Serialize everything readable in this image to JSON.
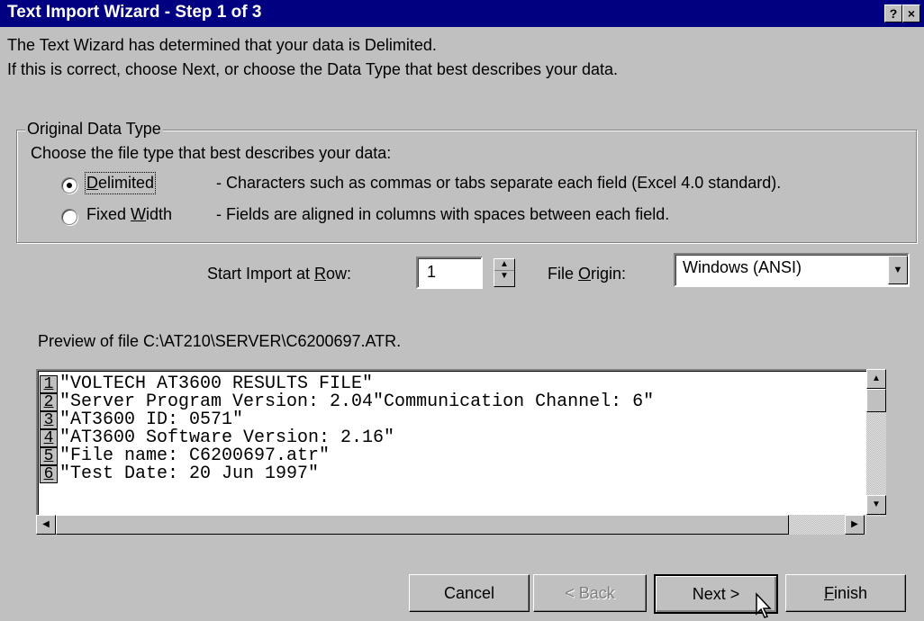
{
  "window": {
    "title": "Text Import Wizard - Step 1 of 3",
    "help_btn": "?",
    "close_btn": "×"
  },
  "intro": {
    "line1": "The Text Wizard has determined that your data is Delimited.",
    "line2": "If this is correct, choose Next, or choose the Data Type that best describes your data."
  },
  "data_type": {
    "legend": "Original Data Type",
    "prompt": "Choose the file type that best describes your data:",
    "options": [
      {
        "label": "Delimited",
        "desc": "- Characters such as commas or tabs separate each field (Excel 4.0 standard).",
        "selected": true
      },
      {
        "label": "Fixed Width",
        "desc": "- Fields are aligned in columns with spaces between each field.",
        "selected": false
      }
    ]
  },
  "import_row": {
    "label_pre": "Start Import at ",
    "label_key": "R",
    "label_post": "ow:",
    "value": "1"
  },
  "file_origin": {
    "label_pre": "File ",
    "label_key": "O",
    "label_post": "rigin:",
    "value": "Windows (ANSI)"
  },
  "preview": {
    "label": "Preview of file C:\\AT210\\SERVER\\C6200697.ATR.",
    "rows": [
      {
        "num": "1",
        "text": "\"VOLTECH AT3600 RESULTS FILE\""
      },
      {
        "num": "2",
        "text": "\"Server Program Version: 2.04\"Communication Channel: 6\""
      },
      {
        "num": "3",
        "text": "\"AT3600 ID: 0571\""
      },
      {
        "num": "4",
        "text": "\"AT3600 Software Version: 2.16\""
      },
      {
        "num": "5",
        "text": "\"File name: C6200697.atr\""
      },
      {
        "num": "6",
        "text": "\"Test Date: 20 Jun 1997\""
      }
    ]
  },
  "buttons": {
    "cancel": "Cancel",
    "back": "< Back",
    "next": "Next >",
    "finish_key": "F",
    "finish_rest": "inish"
  }
}
